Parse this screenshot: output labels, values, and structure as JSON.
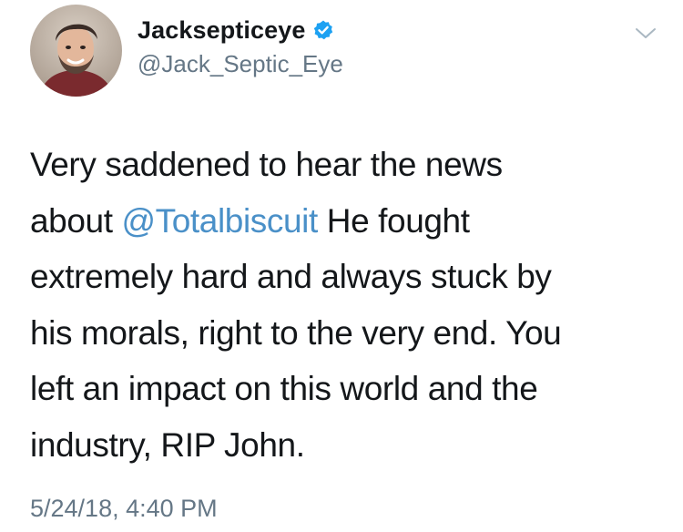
{
  "tweet": {
    "display_name": "Jacksepticeye",
    "handle": "@Jack_Septic_Eye",
    "verified_icon": "verified-badge-icon",
    "menu_icon": "chevron-down-icon",
    "colors": {
      "name": "#14171a",
      "secondary": "#657786",
      "mention": "#4a90c8",
      "verified": "#1da1f2"
    },
    "body": {
      "line1": "Very saddened to hear the news",
      "line2_prefix": "about ",
      "mention": "@Totalbiscuit",
      "line2_suffix": " He fought",
      "line3": "extremely hard and always stuck by",
      "line4": "his morals, right to the very end. You",
      "line5": "left an impact on this world and the",
      "line6": "industry, RIP John."
    },
    "timestamp": "5/24/18, 4:40 PM"
  }
}
